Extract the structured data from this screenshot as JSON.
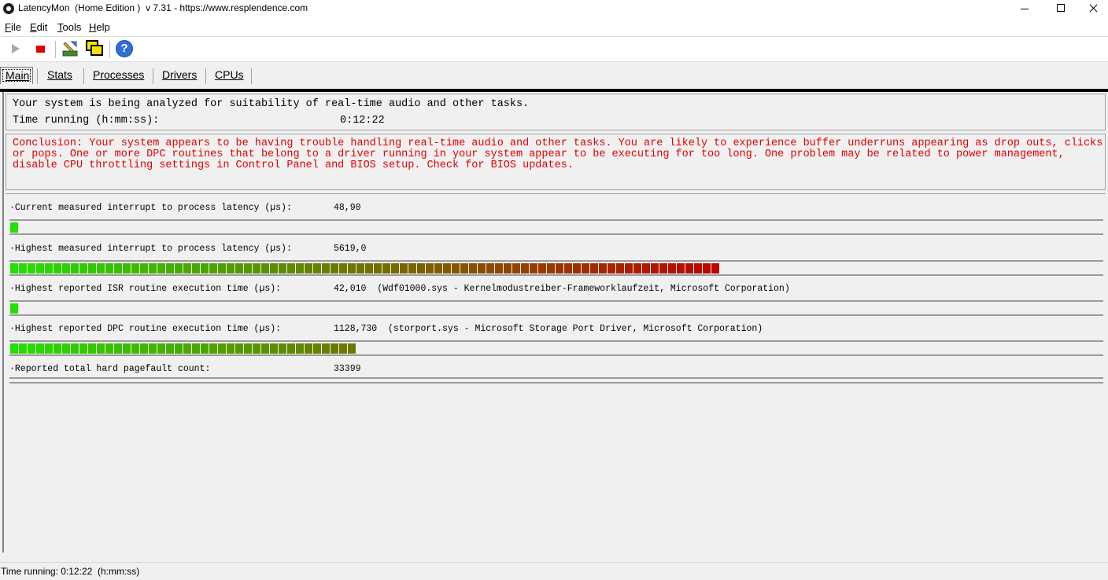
{
  "window": {
    "title": "LatencyMon  (Home Edition )  v 7.31 - https://www.resplendence.com"
  },
  "menu": [
    "File",
    "Edit",
    "Tools",
    "Help"
  ],
  "toolbar": {
    "icons": [
      "play-icon",
      "stop-icon",
      "tools-icon",
      "windows-icon",
      "help-icon"
    ],
    "help_glyph": "?"
  },
  "tabs": [
    "Main",
    "Stats",
    "Processes",
    "Drivers",
    "CPUs"
  ],
  "main": {
    "analysis_text": "Your system is being analyzed for suitability of real-time audio and other tasks.",
    "time_label": "Time running (h:mm:ss):",
    "time_value": "0:12:22",
    "conclusion": "Conclusion: Your system appears to be having trouble handling real-time audio and other tasks. You are likely to experience buffer underruns appearing as drop outs, clicks or pops. One or more DPC routines that belong to a driver running in your system appear to be executing for too long. One problem may be related to power management, disable CPU throttling settings in Control Panel and BIOS setup. Check for BIOS updates.",
    "metrics": [
      {
        "label": "·Current measured interrupt to process latency (µs):",
        "value": "48,90",
        "detail": "",
        "segments": 1
      },
      {
        "label": "·Highest measured interrupt to process latency (µs):",
        "value": "5619,0",
        "detail": "",
        "segments": 82
      },
      {
        "label": "·Highest reported ISR routine execution time (µs):",
        "value": "42,010",
        "detail": "(Wdf01000.sys - Kernelmodustreiber-Frameworklaufzeit, Microsoft Corporation)",
        "segments": 1
      },
      {
        "label": "·Highest reported DPC routine execution time (µs):",
        "value": "1128,730",
        "detail": "(storport.sys - Microsoft Storage Port Driver, Microsoft Corporation)",
        "segments": 40
      },
      {
        "label": "·Reported total hard pagefault count:",
        "value": "33399",
        "detail": "",
        "segments": 0
      }
    ]
  },
  "status_bar": "Time running: 0:12:22  (h:mm:ss)",
  "colors": {
    "bar_green": "#22e000",
    "bar_red": "#c00000",
    "conclusion_red": "#e00000"
  }
}
